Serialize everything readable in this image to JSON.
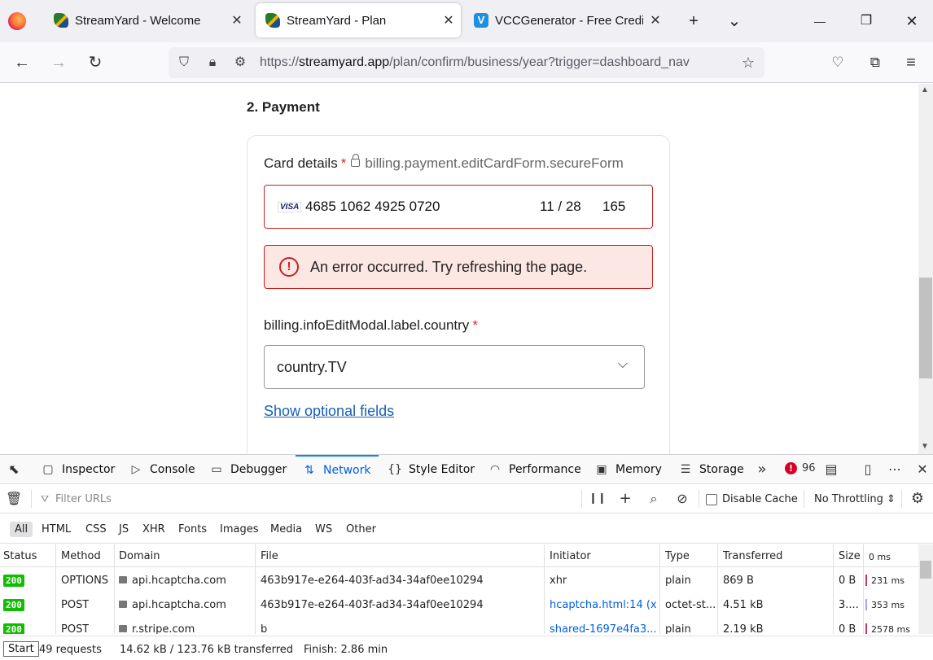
{
  "browser": {
    "tabs": [
      {
        "title": "StreamYard - Welcome",
        "close": "✕"
      },
      {
        "title": "StreamYard - Plan",
        "close": "✕"
      },
      {
        "title": "VCCGenerator - Free Credit Card",
        "close": "✕"
      }
    ],
    "new_tab": "+",
    "tab_list": "⌄",
    "window": {
      "minimize": "—",
      "restore": "❐",
      "close": "✕"
    },
    "url": {
      "prefix": "https://",
      "host": "streamyard.app",
      "path": "/plan/confirm/business/year?trigger=dashboard_nav"
    }
  },
  "page": {
    "step_title": "2.  Payment",
    "card": {
      "label": "Card details",
      "required_mark": "*",
      "secure_text": "billing.payment.editCardForm.secureForm",
      "brand": "VISA",
      "number": "4685 1062 4925 0720",
      "expiry": "11 / 28",
      "cvc": "165"
    },
    "error": {
      "icon": "!",
      "message": "An error occurred. Try refreshing the page."
    },
    "country": {
      "label": "billing.infoEditModal.label.country",
      "required_mark": "*",
      "value": "country.TV"
    },
    "optional_link": "Show optional fields"
  },
  "devtools": {
    "tabs": [
      {
        "label": "Inspector",
        "icon": "inspector-icon"
      },
      {
        "label": "Console",
        "icon": "console-icon"
      },
      {
        "label": "Debugger",
        "icon": "debugger-icon"
      },
      {
        "label": "Network",
        "icon": "network-icon"
      },
      {
        "label": "Style Editor",
        "icon": "style-editor-icon"
      },
      {
        "label": "Performance",
        "icon": "performance-icon"
      },
      {
        "label": "Memory",
        "icon": "memory-icon"
      },
      {
        "label": "Storage",
        "icon": "storage-icon"
      }
    ],
    "error_count": "96",
    "filter_placeholder": "Filter URLs",
    "disable_cache": "Disable Cache",
    "throttling": "No Throttling ⇕",
    "filters": [
      "All",
      "HTML",
      "CSS",
      "JS",
      "XHR",
      "Fonts",
      "Images",
      "Media",
      "WS",
      "Other"
    ],
    "columns": {
      "status": "Status",
      "method": "Method",
      "domain": "Domain",
      "file": "File",
      "initiator": "Initiator",
      "type": "Type",
      "transferred": "Transferred",
      "size": "Size",
      "waterfall": "0 ms"
    },
    "rows": [
      {
        "status": "200",
        "method": "OPTIONS",
        "domain": "api.hcaptcha.com",
        "file": "463b917e-e264-403f-ad34-34af0ee10294",
        "initiator": "xhr",
        "type": "plain",
        "transferred": "869 B",
        "size": "0 B",
        "time": "231 ms"
      },
      {
        "status": "200",
        "method": "POST",
        "domain": "api.hcaptcha.com",
        "file": "463b917e-e264-403f-ad34-34af0ee10294",
        "initiator": "hcaptcha.html:14 (x...",
        "type": "octet-st...",
        "transferred": "4.51 kB",
        "size": "3....",
        "time": "353 ms"
      },
      {
        "status": "200",
        "method": "POST",
        "domain": "r.stripe.com",
        "file": "b",
        "initiator": "shared-1697e4fa3...",
        "type": "plain",
        "transferred": "2.19 kB",
        "size": "0 B",
        "time": "2578 ms"
      }
    ],
    "status_bar": {
      "tooltip": "Start",
      "requests": "49 requests",
      "transferred": "14.62 kB / 123.76 kB transferred",
      "finish": "Finish: 2.86 min"
    }
  }
}
